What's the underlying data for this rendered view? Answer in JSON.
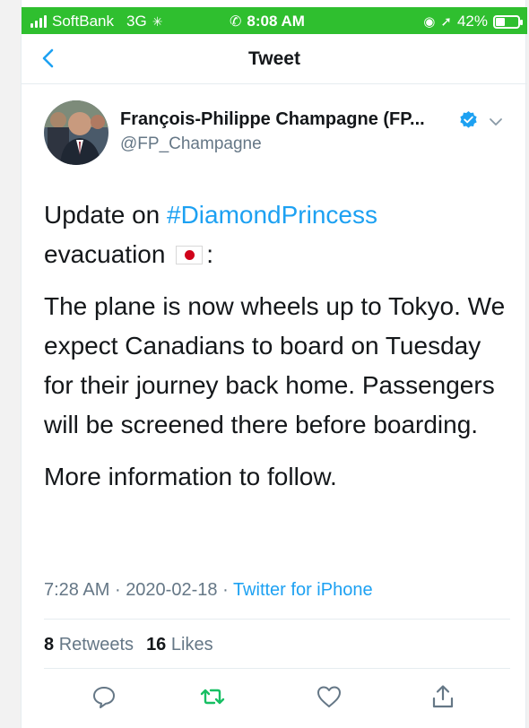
{
  "status_bar": {
    "carrier": "SoftBank",
    "network": "3G",
    "time": "8:08 AM",
    "battery_text": "42%",
    "battery_level": 0.42,
    "color": "#2fbf2f"
  },
  "nav": {
    "title": "Tweet",
    "back_icon": "chevron-left-icon"
  },
  "author": {
    "name": "François-Philippe Champagne (FP...",
    "handle": "@FP_Champagne",
    "verified": true
  },
  "tweet": {
    "line1_prefix": "Update on ",
    "hashtag": "#DiamondPrincess",
    "line2_text": "evacuation",
    "line2_suffix": ":",
    "paragraph2": "The plane is now wheels up to Tokyo. We expect Canadians to board on Tuesday for their journey back home. Passengers will be screened there before boarding.",
    "paragraph3": "More information to follow."
  },
  "meta": {
    "time": "7:28 AM",
    "separator": "·",
    "date": "2020-02-18",
    "source": "Twitter for iPhone"
  },
  "stats": {
    "retweets_count": "8",
    "retweets_label": "Retweets",
    "likes_count": "16",
    "likes_label": "Likes"
  },
  "actions": [
    "reply-icon",
    "retweet-icon",
    "like-icon",
    "share-icon"
  ],
  "colors": {
    "link": "#1da1f2",
    "secondary": "#657786",
    "retweet": "#17bf63"
  }
}
